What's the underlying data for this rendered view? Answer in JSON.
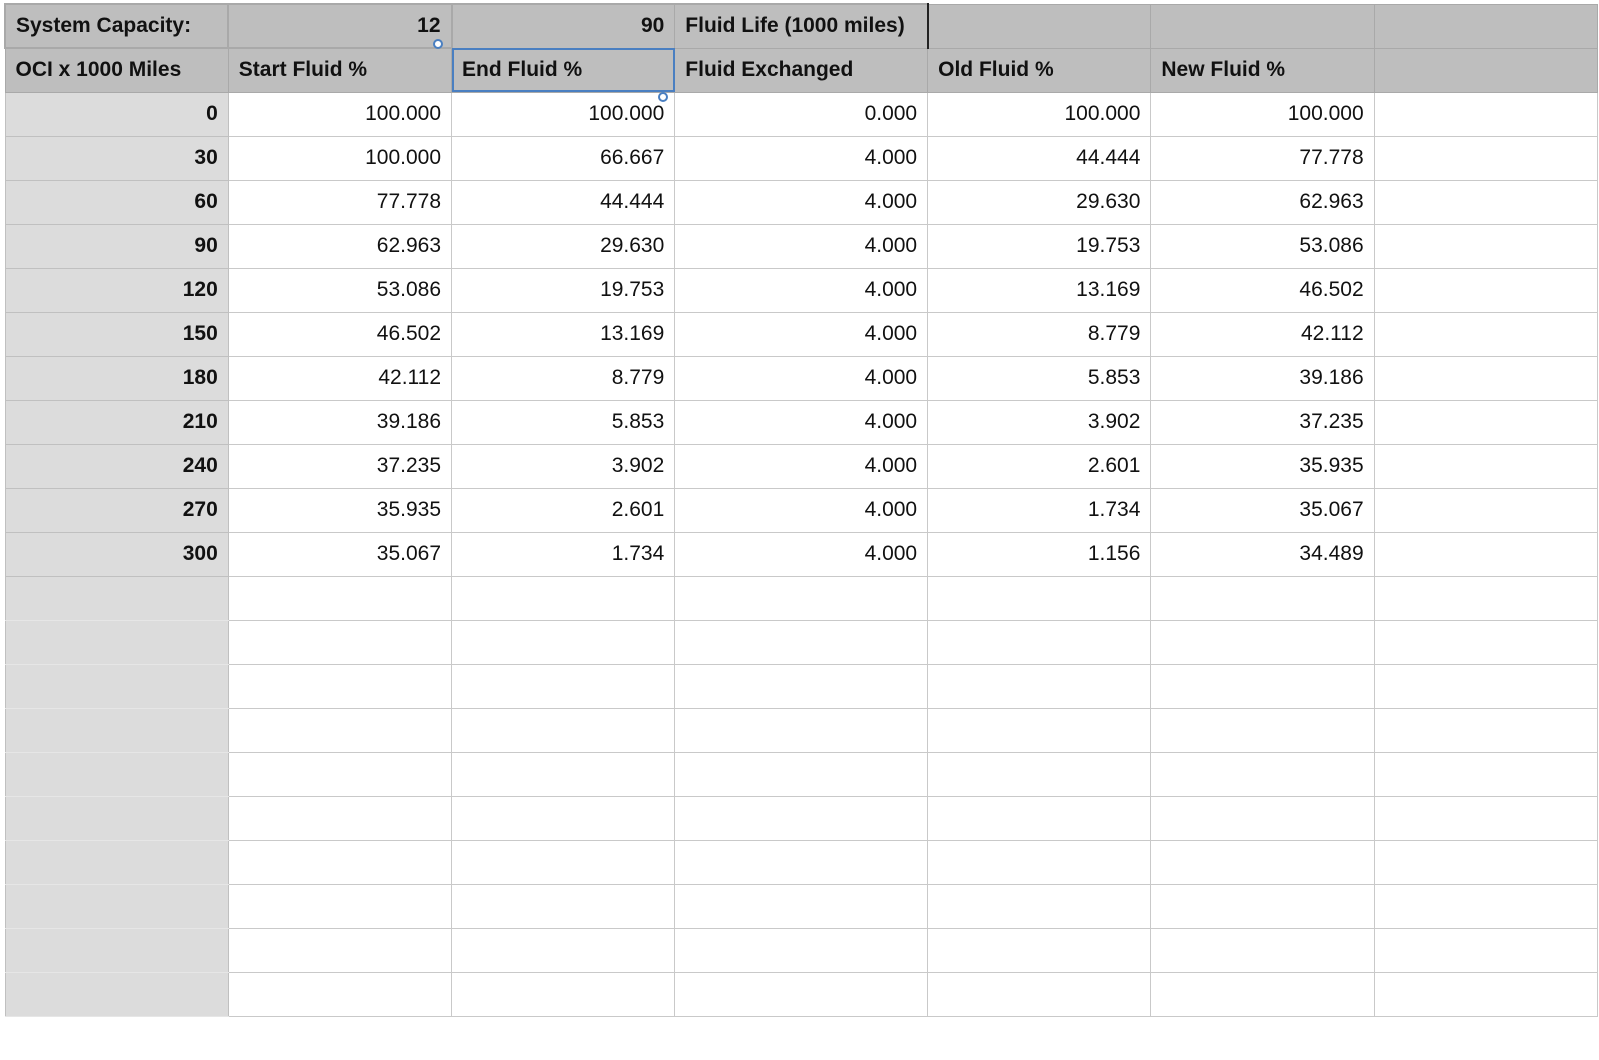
{
  "top_row": {
    "label": "System Capacity:",
    "capacity": "12",
    "fluid_life_value": "90",
    "fluid_life_label": "Fluid Life (1000 miles)"
  },
  "headers": [
    "OCI x 1000 Miles",
    "Start Fluid %",
    "End Fluid %",
    "Fluid Exchanged",
    "Old Fluid %",
    "New Fluid %",
    ""
  ],
  "rows": [
    [
      "0",
      "100.000",
      "100.000",
      "0.000",
      "100.000",
      "100.000"
    ],
    [
      "30",
      "100.000",
      "66.667",
      "4.000",
      "44.444",
      "77.778"
    ],
    [
      "60",
      "77.778",
      "44.444",
      "4.000",
      "29.630",
      "62.963"
    ],
    [
      "90",
      "62.963",
      "29.630",
      "4.000",
      "19.753",
      "53.086"
    ],
    [
      "120",
      "53.086",
      "19.753",
      "4.000",
      "13.169",
      "46.502"
    ],
    [
      "150",
      "46.502",
      "13.169",
      "4.000",
      "8.779",
      "42.112"
    ],
    [
      "180",
      "42.112",
      "8.779",
      "4.000",
      "5.853",
      "39.186"
    ],
    [
      "210",
      "39.186",
      "5.853",
      "4.000",
      "3.902",
      "37.235"
    ],
    [
      "240",
      "37.235",
      "3.902",
      "4.000",
      "2.601",
      "35.935"
    ],
    [
      "270",
      "35.935",
      "2.601",
      "4.000",
      "1.734",
      "35.067"
    ],
    [
      "300",
      "35.067",
      "1.734",
      "4.000",
      "1.156",
      "34.489"
    ]
  ],
  "empty_row_count": 10,
  "selected_cell": "End Fluid %",
  "colors": {
    "header_bg": "#bebebe",
    "row_header_bg": "#dcdcdc",
    "selection": "#4a7fc1"
  }
}
